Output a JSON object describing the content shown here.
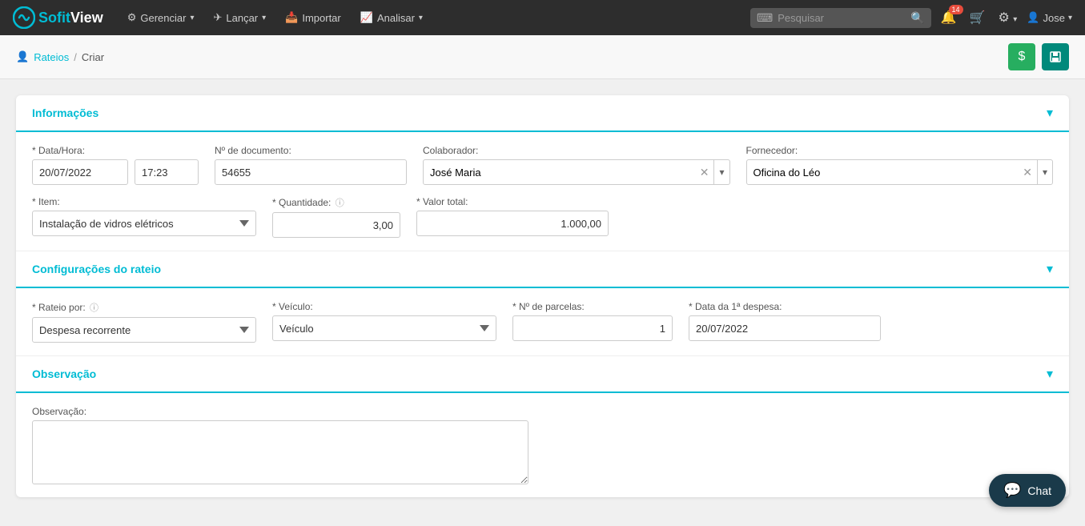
{
  "app": {
    "logo_sofitview": "SofitView",
    "logo_sofit": "Sofit",
    "logo_view": "View"
  },
  "topnav": {
    "menu_items": [
      {
        "id": "gerenciar",
        "label": "Gerenciar",
        "has_dropdown": true,
        "icon": "⚙"
      },
      {
        "id": "lancar",
        "label": "Lançar",
        "has_dropdown": true,
        "icon": "✈"
      },
      {
        "id": "importar",
        "label": "Importar",
        "has_dropdown": false,
        "icon": "📥"
      },
      {
        "id": "analisar",
        "label": "Analisar",
        "has_dropdown": true,
        "icon": "📈"
      }
    ],
    "search_placeholder": "Pesquisar",
    "notification_count": "14",
    "user_name": "Jose"
  },
  "breadcrumb": {
    "parent_label": "Rateios",
    "parent_icon": "👤",
    "separator": "/",
    "current": "Criar"
  },
  "toolbar": {
    "btn_dollar": "$",
    "btn_save": "💾"
  },
  "sections": {
    "informacoes": {
      "title": "Informações",
      "fields": {
        "data_hora_label": "* Data/Hora:",
        "data_value": "20/07/2022",
        "hora_value": "17:23",
        "nro_documento_label": "Nº de documento:",
        "nro_documento_value": "54655",
        "colaborador_label": "Colaborador:",
        "colaborador_value": "José Maria",
        "fornecedor_label": "Fornecedor:",
        "fornecedor_value": "Oficina do Léo",
        "item_label": "* Item:",
        "item_value": "Instalação de vidros elétricos",
        "quantidade_label": "* Quantidade:",
        "quantidade_value": "3,00",
        "valor_total_label": "* Valor total:",
        "valor_total_value": "1.000,00"
      }
    },
    "configuracoes": {
      "title": "Configurações do rateio",
      "fields": {
        "rateio_por_label": "* Rateio por:",
        "rateio_por_value": "Despesa recorrente",
        "veiculo_label": "* Veículo:",
        "veiculo_placeholder": "Veículo",
        "parcelas_label": "* Nº de parcelas:",
        "parcelas_value": "1",
        "data_primeira_label": "* Data da 1ª despesa:",
        "data_primeira_value": "20/07/2022"
      }
    },
    "observacao": {
      "title": "Observação",
      "fields": {
        "observacao_label": "Observação:",
        "observacao_value": ""
      }
    }
  },
  "chat": {
    "label": "Chat"
  }
}
